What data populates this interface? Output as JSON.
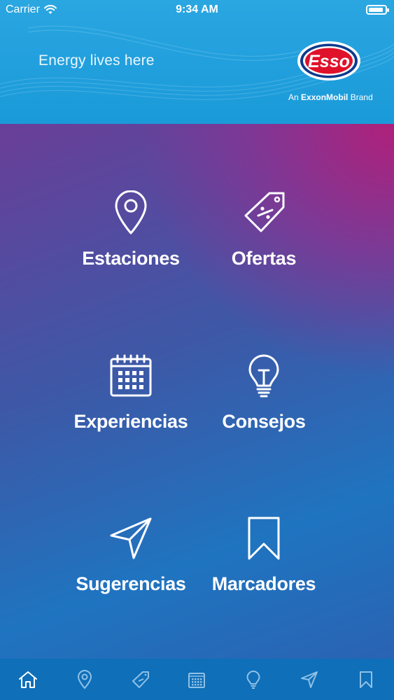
{
  "status_bar": {
    "carrier": "Carrier",
    "time": "9:34 AM",
    "battery_level": 0.9
  },
  "header": {
    "tagline": "Energy lives here",
    "logo_text": "Esso",
    "brand_prefix": "An",
    "brand_name": "ExxonMobil",
    "brand_suffix": "Brand"
  },
  "menu": [
    {
      "label": "Estaciones",
      "icon": "location-pin-icon"
    },
    {
      "label": "Ofertas",
      "icon": "price-tag-icon"
    },
    {
      "label": "Experiencias",
      "icon": "calendar-icon"
    },
    {
      "label": "Consejos",
      "icon": "lightbulb-icon"
    },
    {
      "label": "Sugerencias",
      "icon": "send-icon"
    },
    {
      "label": "Marcadores",
      "icon": "bookmark-icon"
    }
  ],
  "tabbar": [
    {
      "icon": "home-icon",
      "active": true
    },
    {
      "icon": "location-pin-icon",
      "active": false
    },
    {
      "icon": "price-tag-icon",
      "active": false
    },
    {
      "icon": "calendar-icon",
      "active": false
    },
    {
      "icon": "lightbulb-icon",
      "active": false
    },
    {
      "icon": "send-icon",
      "active": false
    },
    {
      "icon": "bookmark-icon",
      "active": false
    }
  ],
  "colors": {
    "header": "#1a9ad9",
    "tabbar": "#0f6fb9",
    "logo_red": "#e0112b",
    "logo_blue": "#0c3a8c",
    "inactive_icon": "#8fc1e6"
  }
}
